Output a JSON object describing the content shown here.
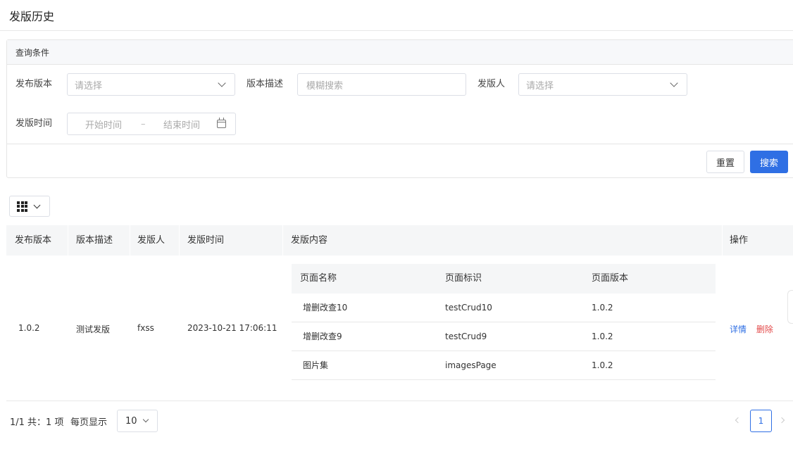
{
  "page": {
    "title": "发版历史"
  },
  "query": {
    "header": "查询条件",
    "fields": {
      "version_label": "发布版本",
      "version_placeholder": "请选择",
      "desc_label": "版本描述",
      "desc_placeholder": "模糊搜索",
      "publisher_label": "发版人",
      "publisher_placeholder": "请选择",
      "time_label": "发版时间",
      "time_start_placeholder": "开始时间",
      "time_separator": "–",
      "time_end_placeholder": "结束时间"
    },
    "buttons": {
      "reset": "重置",
      "search": "搜索"
    }
  },
  "table": {
    "columns": [
      "发布版本",
      "版本描述",
      "发版人",
      "发版时间",
      "发版内容",
      "操作"
    ],
    "rows": [
      {
        "version": "1.0.2",
        "description": "测试发版",
        "publisher": "fxss",
        "time": "2023-10-21 17:06:11",
        "content": {
          "columns": [
            "页面名称",
            "页面标识",
            "页面版本"
          ],
          "rows": [
            [
              "增删改查10",
              "testCrud10",
              "1.0.2"
            ],
            [
              "增删改查9",
              "testCrud9",
              "1.0.2"
            ],
            [
              "图片集",
              "imagesPage",
              "1.0.2"
            ]
          ]
        },
        "actions": {
          "detail": "详情",
          "delete": "删除"
        }
      }
    ]
  },
  "pagination": {
    "summary": "1/1 共：1 项",
    "per_page_label": "每页显示",
    "per_page_value": "10",
    "current_page": "1"
  },
  "colors": {
    "primary": "#2f6fe4",
    "danger": "#e34b4b",
    "header_bg": "#f5f6f7"
  }
}
